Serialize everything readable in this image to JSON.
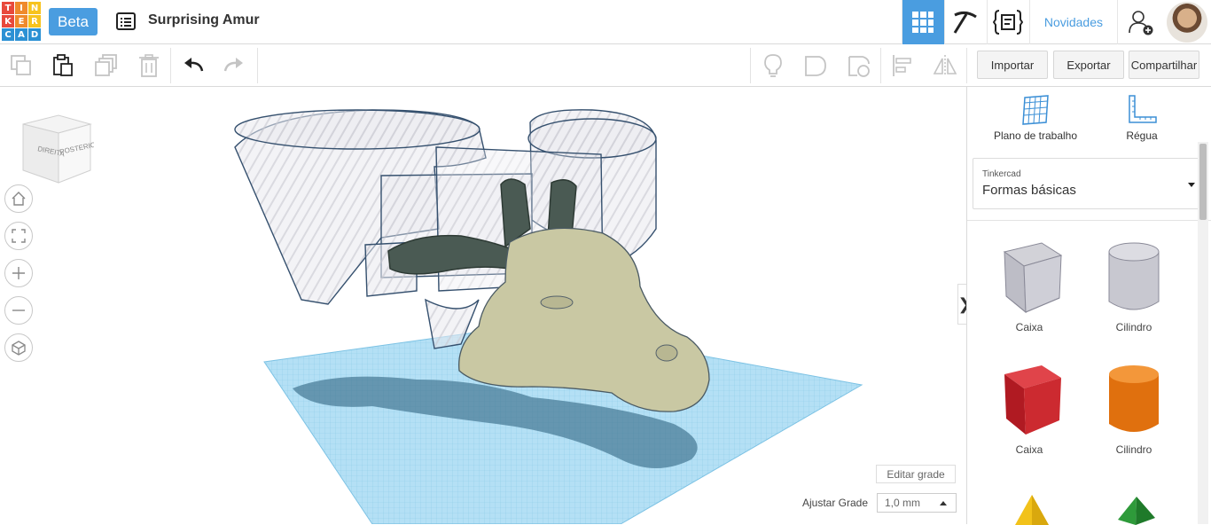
{
  "header": {
    "logo_letters": [
      "T",
      "I",
      "N",
      "K",
      "E",
      "R",
      "C",
      "A",
      "D"
    ],
    "logo_colors": [
      "#e8493c",
      "#ef8a2c",
      "#f7c31e",
      "#e8493c",
      "#ef8a2c",
      "#f7c31e",
      "#2b91d4",
      "#2b91d4",
      "#2b91d4"
    ],
    "beta_label": "Beta",
    "design_title": "Surprising Amur",
    "novidades_label": "Novidades",
    "accent_color": "#4a9de0"
  },
  "toolbar": {
    "icons": [
      "copy-icon",
      "paste-icon",
      "duplicate-icon",
      "delete-icon",
      "undo-icon",
      "redo-icon",
      "lightbulb-icon",
      "shape-icon",
      "hole-icon",
      "align-icon",
      "mirror-icon"
    ],
    "importar_label": "Importar",
    "exportar_label": "Exportar",
    "compartilhar_label": "Compartilhar"
  },
  "viewcube": {
    "left_face": "DIREITA",
    "right_face": "POSTERIOR"
  },
  "workplane": {
    "edit_grid_label": "Editar grade",
    "snap_label": "Ajustar Grade",
    "snap_value": "1,0 mm",
    "grid_color": "#a8dbf2"
  },
  "sidepanel": {
    "workplane_label": "Plano de trabalho",
    "ruler_label": "Régua",
    "library_small": "Tinkercad",
    "library_name": "Formas básicas",
    "shapes": [
      {
        "label": "Caixa"
      },
      {
        "label": "Cilindro"
      },
      {
        "label": "Caixa"
      },
      {
        "label": "Cilindro"
      }
    ]
  }
}
